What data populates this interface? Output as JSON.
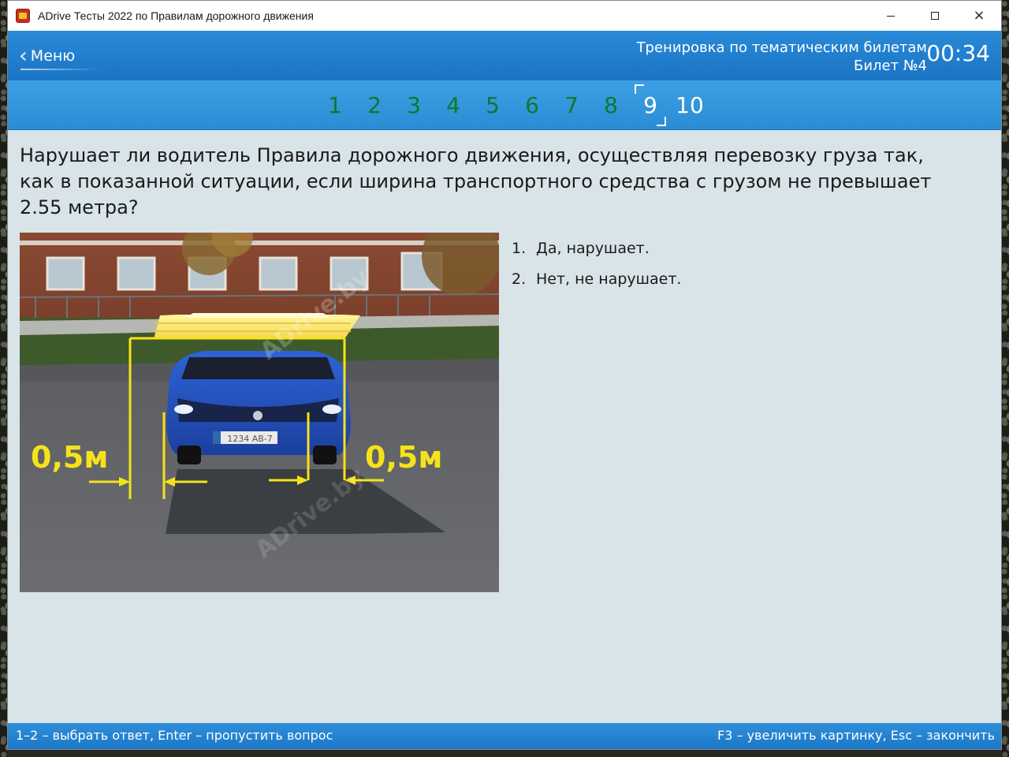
{
  "window": {
    "title": "ADrive Тесты 2022 по Правилам дорожного движения",
    "controls": {
      "minimize": "minimize",
      "maximize": "maximize",
      "close": "×"
    }
  },
  "header": {
    "menu_label": "Меню",
    "mode": "Тренировка по тематическим билетам",
    "ticket": "Билет №4",
    "timer": "00:34"
  },
  "questions_nav": {
    "items": [
      "1",
      "2",
      "3",
      "4",
      "5",
      "6",
      "7",
      "8",
      "9",
      "10"
    ],
    "current": "9",
    "answered_color": "#0d7a2a"
  },
  "question": {
    "text": "Нарушает ли водитель Правила дорожного движения, осуществляя перевозку груза так, как в показанной ситуации, если ширина транспортного средства с грузом не превышает 2.55 метра?"
  },
  "image": {
    "label_left": "0,5м",
    "label_right": "0,5м",
    "watermark": "ADrive.by",
    "plate": "1234 AB-7"
  },
  "answers": [
    {
      "num": "1.",
      "text": "Да, нарушает."
    },
    {
      "num": "2.",
      "text": "Нет, не нарушает."
    }
  ],
  "footer": {
    "left": "1–2 – выбрать ответ, Enter – пропустить вопрос",
    "right": "F3 – увеличить картинку, Esc – закончить"
  },
  "colors": {
    "header_blue": "#1a74c4",
    "content_bg": "#d9e4e8",
    "marker_yellow": "#f6e21a"
  }
}
